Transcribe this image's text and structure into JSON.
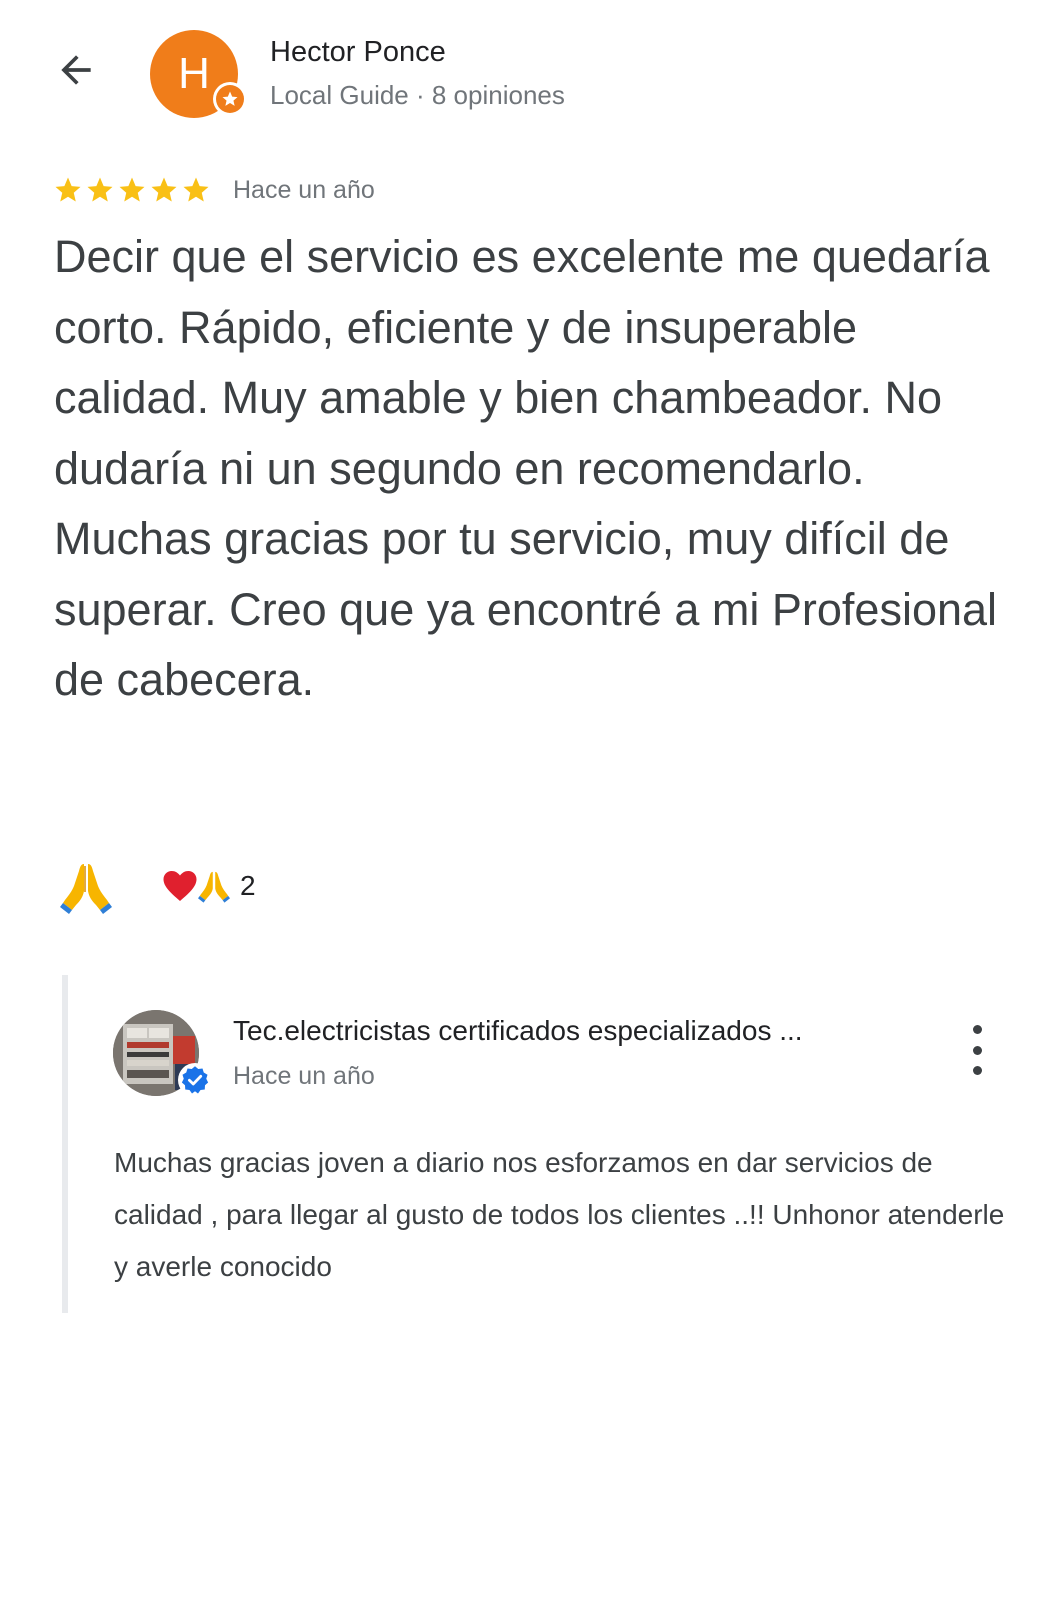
{
  "reviewer": {
    "initial": "H",
    "name": "Hector Ponce",
    "meta": "Local Guide · 8 opiniones",
    "avatar_color": "#f07d1a"
  },
  "review": {
    "rating": 5,
    "max_rating": 5,
    "star_color": "#f9c016",
    "date": "Hace un año",
    "text": "Decir que el servicio es excelente me quedaría corto. Rápido, eficiente y de insuperable calidad. Muy amable y bien chambeador. No dudaría ni un segundo en recomendarlo. Muchas gracias por tu servicio, muy difícil de superar. Creo que ya encontré a mi Profesional de cabecera."
  },
  "reactions": {
    "react_icon": "folded-hands-icon",
    "summary_icons": [
      "heart-icon",
      "folded-hands-icon"
    ],
    "count": "2"
  },
  "owner_reply": {
    "name": "Tec.electricistas certificados especializados ...",
    "date": "Hace un año",
    "verified_color": "#1a73e8",
    "text": "Muchas gracias joven a diario nos esforzamos en dar servicios de calidad , para llegar al gusto de todos los clientes ..!! Unhonor atenderle y averle conocido"
  }
}
